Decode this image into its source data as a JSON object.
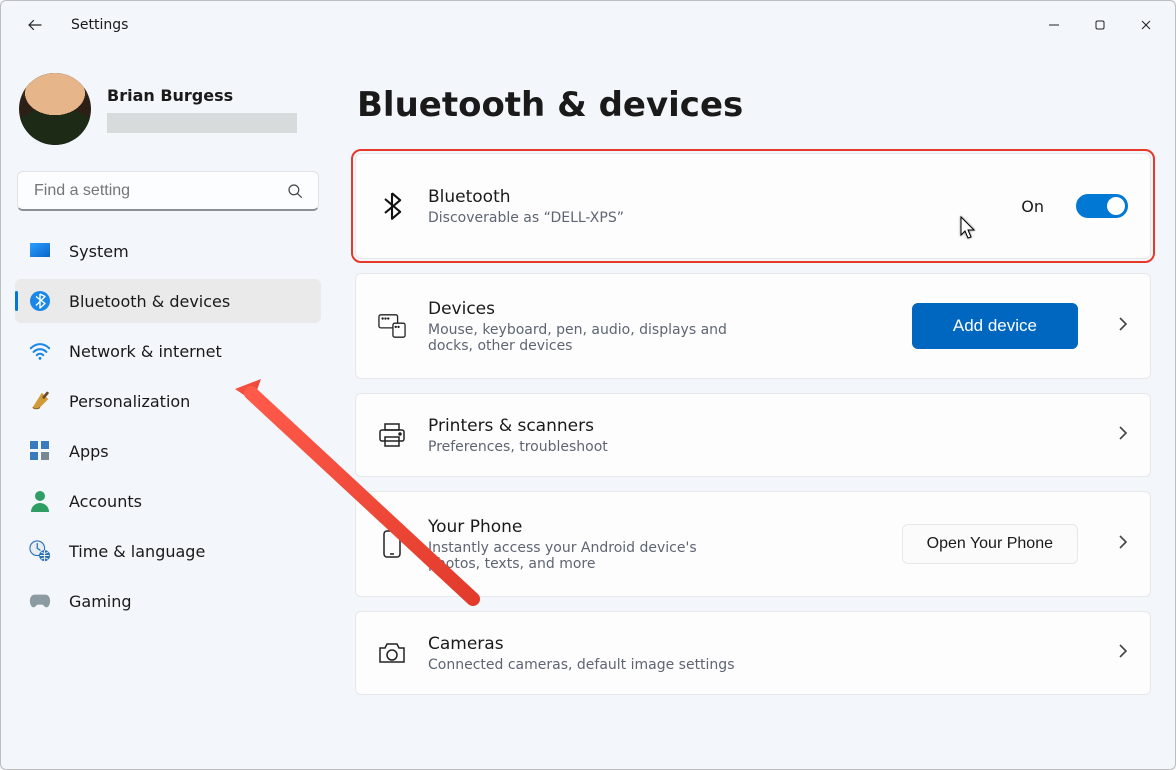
{
  "app": {
    "title": "Settings"
  },
  "profile": {
    "name": "Brian Burgess"
  },
  "search": {
    "placeholder": "Find a setting"
  },
  "nav": {
    "items": [
      {
        "key": "system",
        "label": "System"
      },
      {
        "key": "bluetooth",
        "label": "Bluetooth & devices"
      },
      {
        "key": "network",
        "label": "Network & internet"
      },
      {
        "key": "personalize",
        "label": "Personalization"
      },
      {
        "key": "apps",
        "label": "Apps"
      },
      {
        "key": "accounts",
        "label": "Accounts"
      },
      {
        "key": "time",
        "label": "Time & language"
      },
      {
        "key": "gaming",
        "label": "Gaming"
      }
    ]
  },
  "page": {
    "title": "Bluetooth & devices"
  },
  "bluetooth_card": {
    "title": "Bluetooth",
    "sub": "Discoverable as “DELL-XPS”",
    "state_label": "On"
  },
  "devices_card": {
    "title": "Devices",
    "sub": "Mouse, keyboard, pen, audio, displays and docks, other devices",
    "button": "Add device"
  },
  "printers_card": {
    "title": "Printers & scanners",
    "sub": "Preferences, troubleshoot"
  },
  "phone_card": {
    "title": "Your Phone",
    "sub": "Instantly access your Android device's photos, texts, and more",
    "button": "Open Your Phone"
  },
  "cameras_card": {
    "title": "Cameras",
    "sub": "Connected cameras, default image settings"
  }
}
